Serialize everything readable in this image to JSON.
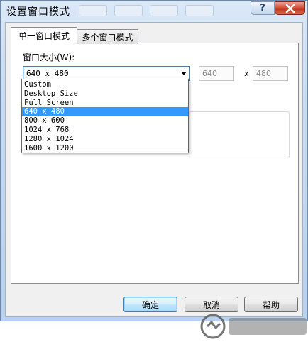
{
  "window": {
    "title": "设置窗口模式"
  },
  "tabs": [
    {
      "label": "单一窗口模式",
      "active": true
    },
    {
      "label": "多个窗口模式",
      "active": false
    }
  ],
  "size_section": {
    "label": "窗口大小(W):",
    "selected_value": "640 x 480",
    "width_value": "640",
    "height_value": "480",
    "separator": "x"
  },
  "dropdown": {
    "options": [
      "Custom",
      "Desktop Size",
      "Full Screen",
      "640 x 480",
      "800 x 600",
      "1024 x 768",
      "1280 x 1024",
      "1600 x 1200"
    ],
    "selected_index": 3
  },
  "buttons": {
    "ok_label": "确定",
    "cancel_label": "取消",
    "help_label": "帮助"
  },
  "colors": {
    "selection": "#3399ff",
    "close_button": "#c0341b",
    "title_bar": "#c9dcf1"
  }
}
